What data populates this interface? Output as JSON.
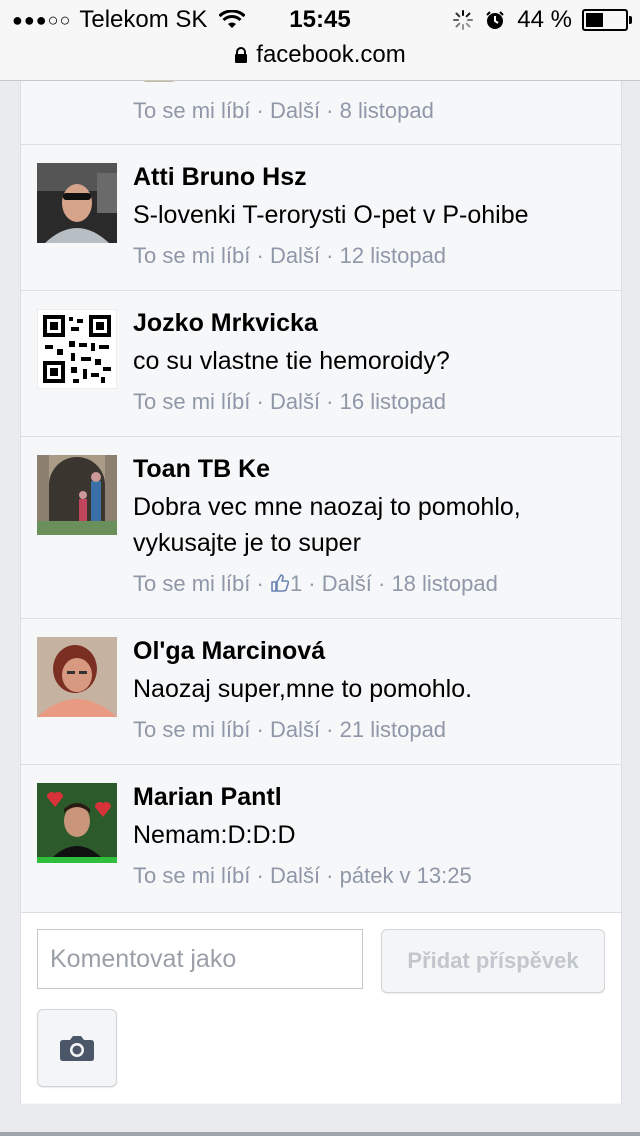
{
  "status_bar": {
    "signal": "●●●○○",
    "carrier": "Telekom SK",
    "time": "15:45",
    "battery": "44 %",
    "battery_level": 0.44
  },
  "url_bar": {
    "domain": "facebook.com"
  },
  "first_comment_meta": {
    "like": "To se mi líbí",
    "more": "Další",
    "date": "8 listopad"
  },
  "comments": [
    {
      "name": "Atti Bruno Hsz",
      "text": "S-lovenki T-erorysti O-pet v P-ohibe",
      "like": "To se mi líbí",
      "more": "Další",
      "date": "12 listopad"
    },
    {
      "name": "Jozko Mrkvicka",
      "text": "co su vlastne tie hemoroidy?",
      "like": "To se mi líbí",
      "more": "Další",
      "date": "16 listopad"
    },
    {
      "name": "Toan TB Ke",
      "text": "Dobra vec mne naozaj to pomohlo, vykusajte je to super",
      "like": "To se mi líbí",
      "likes_count": "1",
      "more": "Další",
      "date": "18 listopad"
    },
    {
      "name": "Ol'ga Marcinová",
      "text": "Naozaj super,mne to pomohlo.",
      "like": "To se mi líbí",
      "more": "Další",
      "date": "21 listopad"
    },
    {
      "name": "Marian Pantl",
      "text": "Nemam:D:D:D",
      "like": "To se mi líbí",
      "more": "Další",
      "date": "pátek v 13:25"
    }
  ],
  "compose": {
    "placeholder": "Komentovat jako",
    "post_button": "Přidat příspěvek"
  },
  "colors": {
    "meta": "#8f97a8",
    "background": "#e9ebee",
    "card": "#f6f7f9",
    "icon": "#4b5668"
  }
}
